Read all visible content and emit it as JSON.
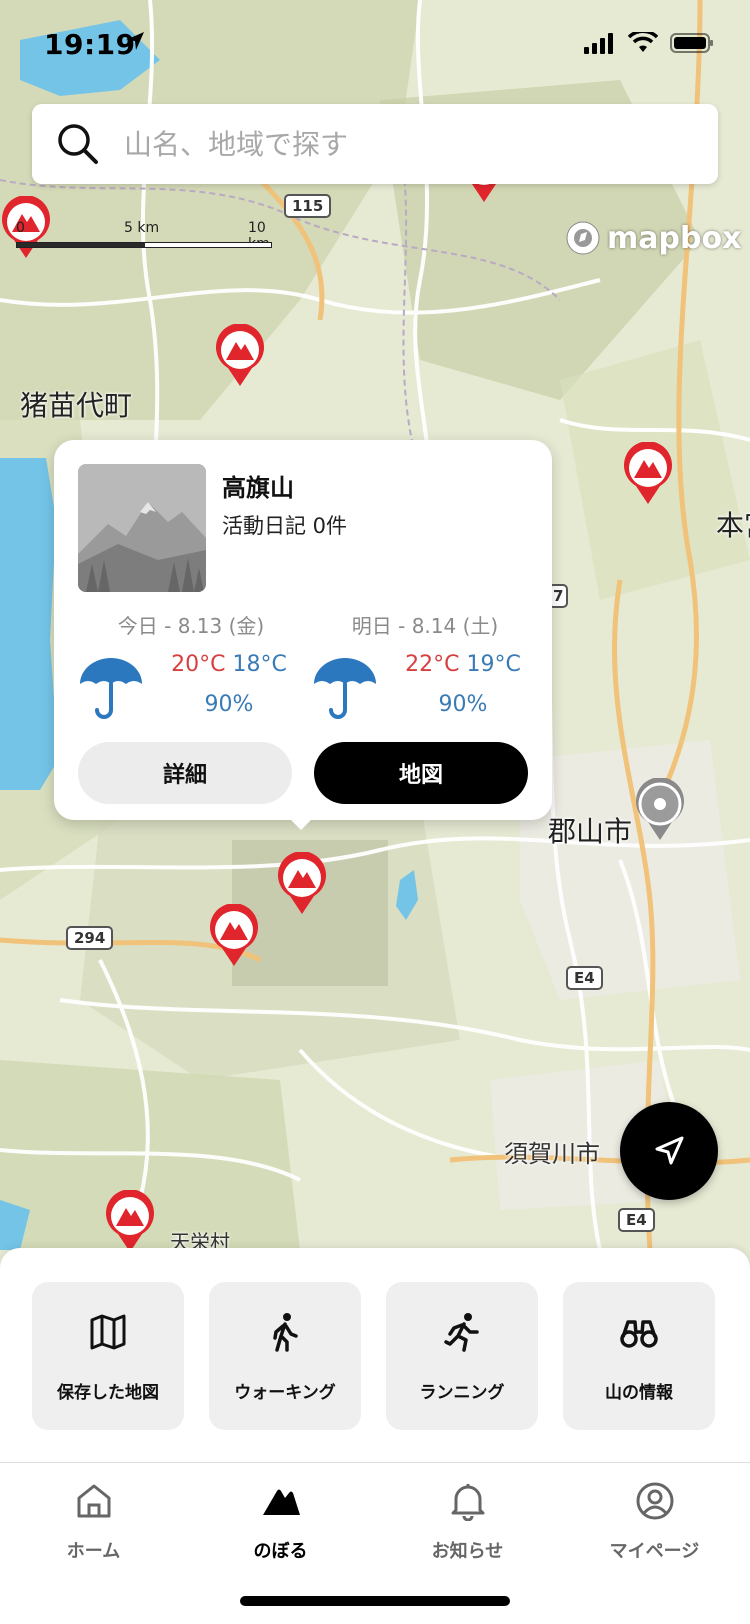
{
  "status": {
    "time": "19:19"
  },
  "search": {
    "placeholder": "山名、地域で探す"
  },
  "scale": {
    "left": "0",
    "mid": "5 km",
    "right": "10 km"
  },
  "mapbox": "mapbox",
  "places": {
    "inawashiro": "猪苗代町",
    "motomiya": "本宮",
    "koriyama": "郡山市",
    "sukagawa": "須賀川市",
    "tenei": "天栄村"
  },
  "roads": {
    "r115": "115",
    "r294": "294",
    "e4a": "E4",
    "e4b": "E4",
    "r7": "7"
  },
  "popup": {
    "mountain_name": "高旗山",
    "diary": "活動日記 0件",
    "today": {
      "label": "今日 - 8.13 (金)",
      "high": "20°C",
      "low": "18°C",
      "rain": "90%"
    },
    "tomorrow": {
      "label": "明日 - 8.14 (土)",
      "high": "22°C",
      "low": "19°C",
      "rain": "90%"
    },
    "detail_button": "詳細",
    "map_button": "地図"
  },
  "quick_actions": [
    {
      "label": "保存した地図",
      "icon": "map-icon"
    },
    {
      "label": "ウォーキング",
      "icon": "walking-icon"
    },
    {
      "label": "ランニング",
      "icon": "running-icon"
    },
    {
      "label": "山の情報",
      "icon": "binoculars-icon"
    }
  ],
  "tabs": [
    {
      "label": "ホーム",
      "icon": "home-icon"
    },
    {
      "label": "のぼる",
      "icon": "climb-icon"
    },
    {
      "label": "お知らせ",
      "icon": "bell-icon"
    },
    {
      "label": "マイページ",
      "icon": "profile-icon"
    }
  ],
  "colors": {
    "pin_red": "#e0262c",
    "temp_high": "#d64040",
    "temp_low": "#3a7bb5",
    "umbrella": "#2c78bf"
  }
}
